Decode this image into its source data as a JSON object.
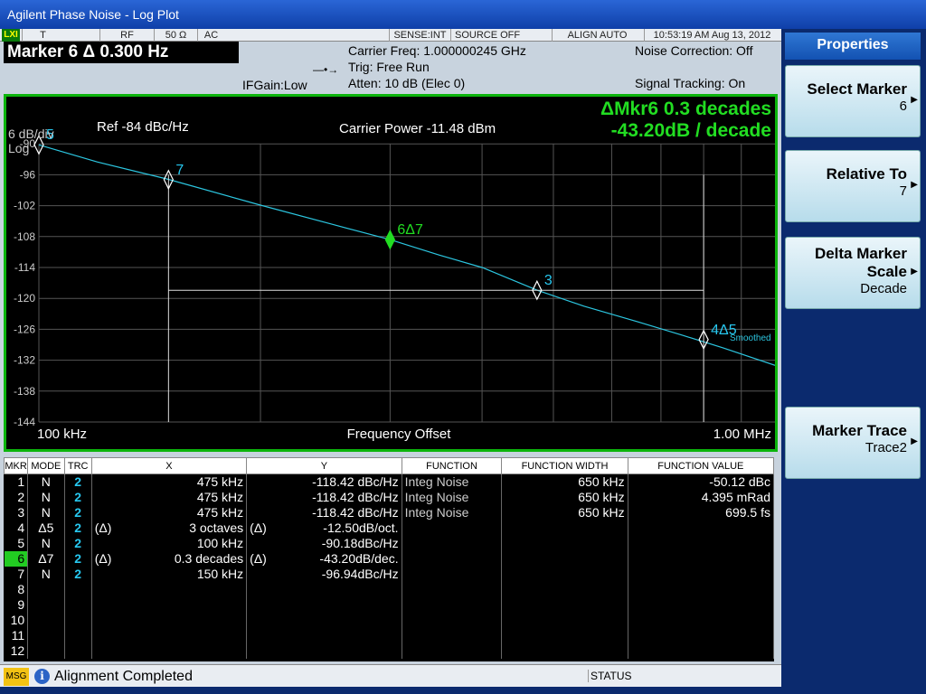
{
  "window": {
    "title": "Agilent Phase Noise - Log Plot"
  },
  "status_bar": {
    "lxi": "LXI",
    "input": "T",
    "rf": "RF",
    "impedance": "50 Ω",
    "coupling": "AC",
    "sense": "SENSE:INT",
    "source": "SOURCE OFF",
    "align": "ALIGN AUTO",
    "datetime": "10:53:19 AM Aug 13, 2012"
  },
  "header": {
    "marker_title": "Marker 6 Δ 0.300 Hz",
    "ifgain": "IFGain:Low",
    "carrier_freq": "Carrier Freq: 1.000000245 GHz",
    "trig": "Trig: Free Run",
    "atten": "Atten: 10 dB (Elec 0)",
    "noise_correction": "Noise Correction: Off",
    "signal_tracking": "Signal Tracking: On"
  },
  "plot": {
    "scale_label": "6 dB/div",
    "scale_type": "Log",
    "ref_label": "Ref  -84 dBc/Hz",
    "carrier_power": "Carrier Power -11.48 dBm",
    "delta_line1": "ΔMkr6 0.3 decades",
    "delta_line2": "-43.20dB / decade",
    "x_start": "100 kHz",
    "x_stop": "1.00 MHz",
    "x_label": "Frequency Offset",
    "smoothed": "Smoothed",
    "y_ticks": [
      "-90",
      "-96",
      "-102",
      "-108",
      "-114",
      "-120",
      "-126",
      "-132",
      "-138",
      "-144"
    ],
    "markers": [
      {
        "label": "5",
        "color": "#27c8f0"
      },
      {
        "label": "7",
        "color": "#27c8f0"
      },
      {
        "label": "6Δ7",
        "color": "#22dd22"
      },
      {
        "label": "3",
        "color": "#27c8f0"
      },
      {
        "label": "4Δ5",
        "color": "#27c8f0"
      }
    ]
  },
  "chart_data": {
    "type": "line",
    "title": "",
    "xlabel": "Frequency Offset",
    "ylabel": "",
    "x_scale": "log",
    "x_unit": "Hz",
    "xlim": [
      100000,
      1000000
    ],
    "ylim": [
      -144,
      -84
    ],
    "y_unit": "dBc/Hz",
    "y_per_div": 6,
    "grid": true,
    "series": [
      {
        "x": [
          100000,
          120000,
          150000,
          200000,
          250000,
          300000,
          350000,
          400000,
          475000,
          550000,
          650000,
          750000,
          850000,
          1000000
        ],
        "y": [
          -90.2,
          -93.5,
          -96.9,
          -101.9,
          -105.6,
          -108.6,
          -111.6,
          -114.0,
          -118.4,
          -121.5,
          -124.5,
          -127.2,
          -129.6,
          -133.0
        ]
      }
    ]
  },
  "table": {
    "headers": [
      "MKR",
      "MODE",
      "TRC",
      "X",
      "Y",
      "FUNCTION",
      "FUNCTION WIDTH",
      "FUNCTION VALUE"
    ],
    "rows": [
      {
        "mkr": "1",
        "mode": "N",
        "trc": "2",
        "xpre": "",
        "x": "475 kHz",
        "ypre": "",
        "y": "-118.42 dBc/Hz",
        "fn": "Integ Noise",
        "fw": "650 kHz",
        "fv": "-50.12 dBc"
      },
      {
        "mkr": "2",
        "mode": "N",
        "trc": "2",
        "xpre": "",
        "x": "475 kHz",
        "ypre": "",
        "y": "-118.42 dBc/Hz",
        "fn": "Integ Noise",
        "fw": "650 kHz",
        "fv": "4.395 mRad"
      },
      {
        "mkr": "3",
        "mode": "N",
        "trc": "2",
        "xpre": "",
        "x": "475 kHz",
        "ypre": "",
        "y": "-118.42 dBc/Hz",
        "fn": "Integ Noise",
        "fw": "650 kHz",
        "fv": "699.5 fs"
      },
      {
        "mkr": "4",
        "mode": "Δ5",
        "trc": "2",
        "xpre": "(Δ)",
        "x": "3 octaves",
        "ypre": "(Δ)",
        "y": "-12.50dB/oct.",
        "fn": "",
        "fw": "",
        "fv": ""
      },
      {
        "mkr": "5",
        "mode": "N",
        "trc": "2",
        "xpre": "",
        "x": "100 kHz",
        "ypre": "",
        "y": "-90.18dBc/Hz",
        "fn": "",
        "fw": "",
        "fv": ""
      },
      {
        "mkr": "6",
        "mode": "Δ7",
        "trc": "2",
        "xpre": "(Δ)",
        "x": "0.3 decades",
        "ypre": "(Δ)",
        "y": "-43.20dB/dec.",
        "fn": "",
        "fw": "",
        "fv": ""
      },
      {
        "mkr": "7",
        "mode": "N",
        "trc": "2",
        "xpre": "",
        "x": "150 kHz",
        "ypre": "",
        "y": "-96.94dBc/Hz",
        "fn": "",
        "fw": "",
        "fv": ""
      },
      {
        "mkr": "8",
        "mode": "",
        "trc": "",
        "xpre": "",
        "x": "",
        "ypre": "",
        "y": "",
        "fn": "",
        "fw": "",
        "fv": ""
      },
      {
        "mkr": "9",
        "mode": "",
        "trc": "",
        "xpre": "",
        "x": "",
        "ypre": "",
        "y": "",
        "fn": "",
        "fw": "",
        "fv": ""
      },
      {
        "mkr": "10",
        "mode": "",
        "trc": "",
        "xpre": "",
        "x": "",
        "ypre": "",
        "y": "",
        "fn": "",
        "fw": "",
        "fv": ""
      },
      {
        "mkr": "11",
        "mode": "",
        "trc": "",
        "xpre": "",
        "x": "",
        "ypre": "",
        "y": "",
        "fn": "",
        "fw": "",
        "fv": ""
      },
      {
        "mkr": "12",
        "mode": "",
        "trc": "",
        "xpre": "",
        "x": "",
        "ypre": "",
        "y": "",
        "fn": "",
        "fw": "",
        "fv": ""
      }
    ],
    "selected_row": "6"
  },
  "message_bar": {
    "tag": "MSG",
    "icon": "info-icon",
    "text": "Alignment Completed",
    "status_label": "STATUS"
  },
  "softkeys": {
    "panel_title": "Properties",
    "keys": [
      {
        "label": "Select Marker",
        "value": "6"
      },
      {
        "label": "Relative To",
        "value": "7"
      },
      {
        "label": "Delta Marker Scale",
        "value": "Decade"
      },
      {
        "label": "Marker Trace",
        "value": "Trace2"
      }
    ]
  },
  "colors": {
    "trace": "#2cc6e0",
    "plot_border": "#0cb40c",
    "delta_text": "#22dd22",
    "softkey_bg": "#d4ecf5",
    "panel_bg": "#0b2a6e"
  }
}
